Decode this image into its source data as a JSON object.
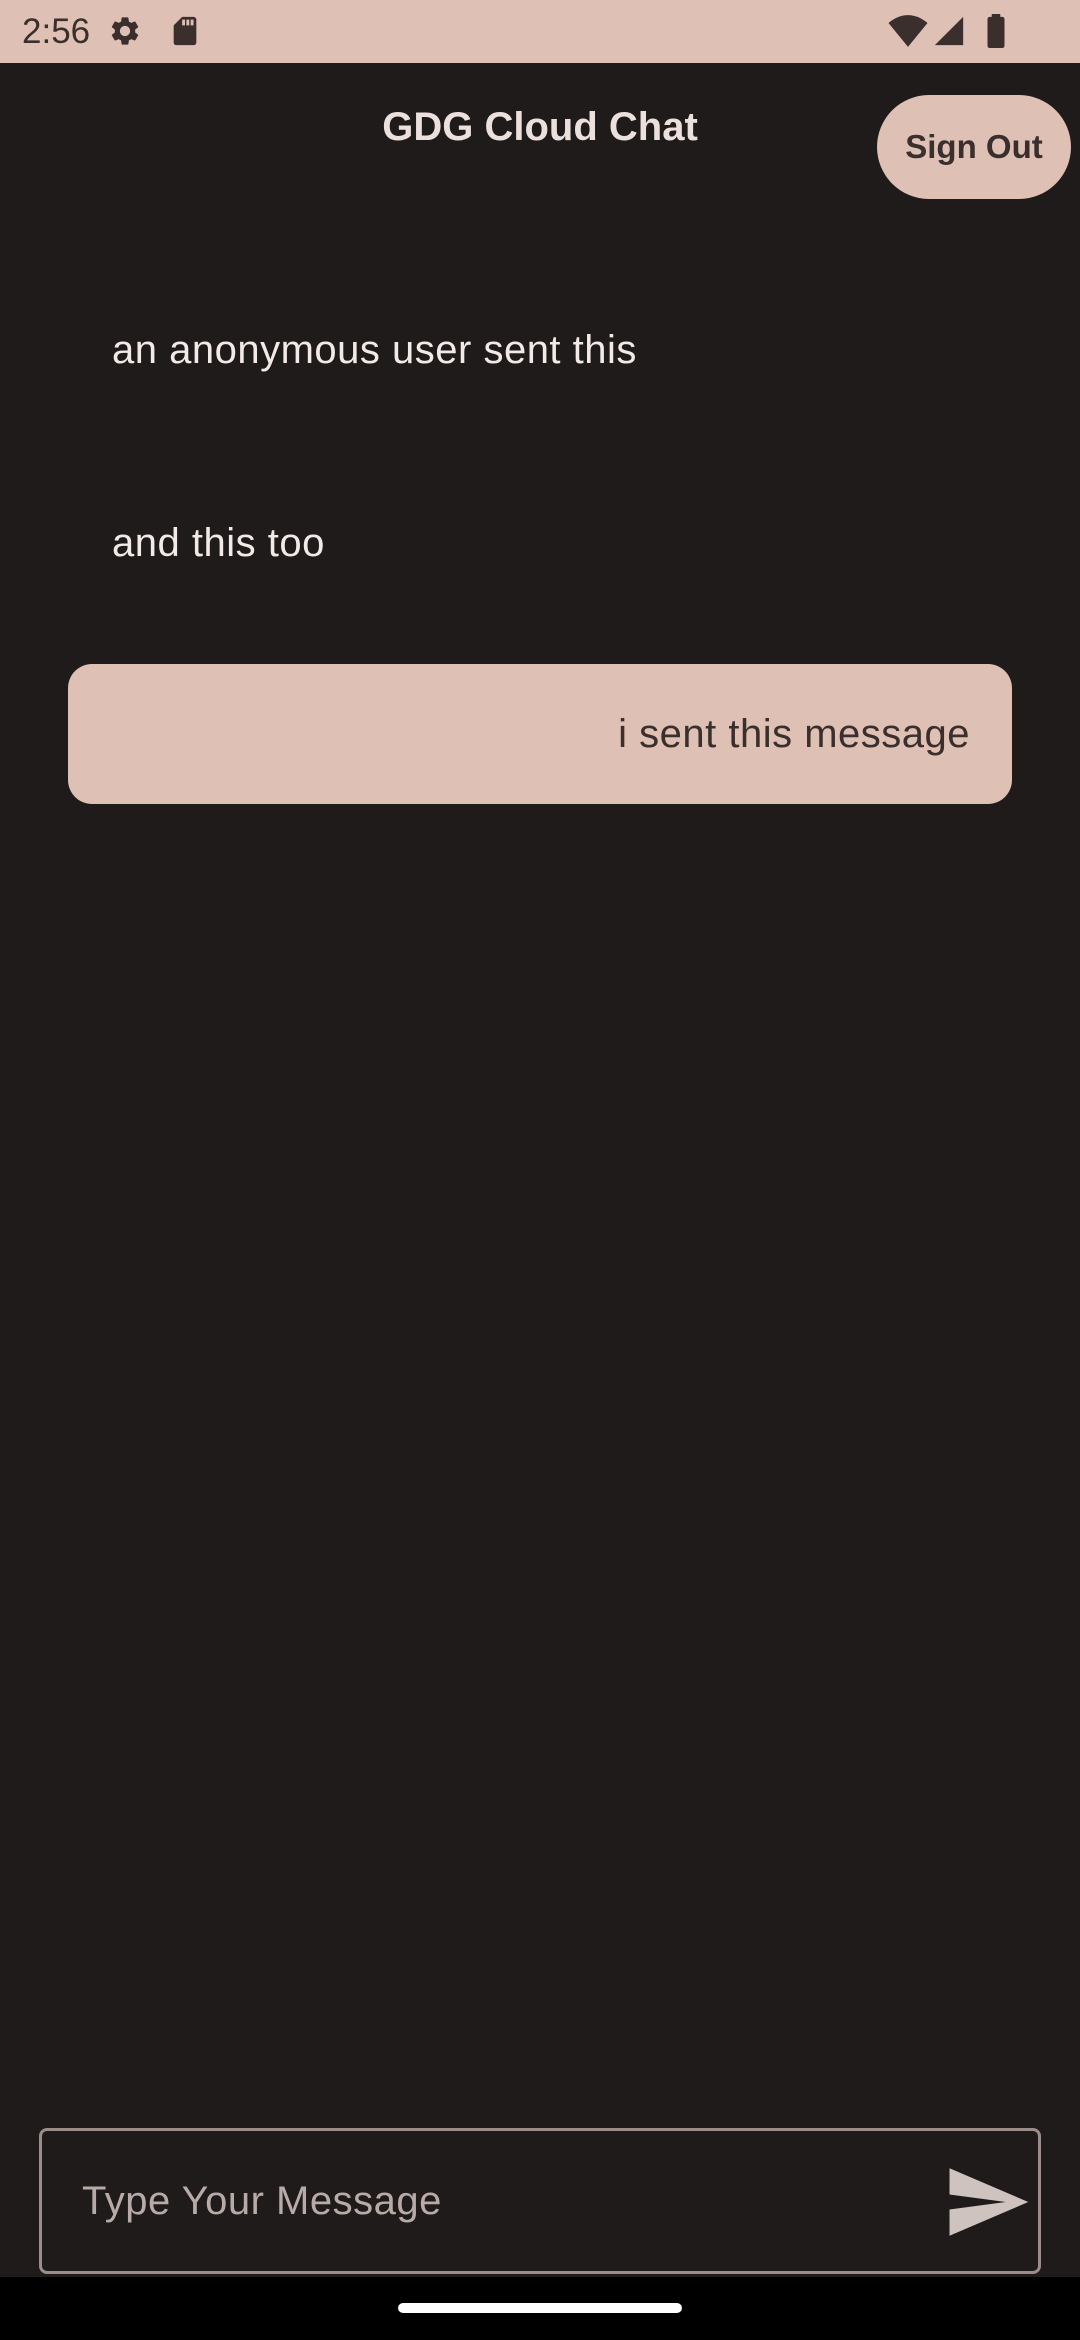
{
  "status_bar": {
    "time": "2:56",
    "icons": [
      "settings-gear-icon",
      "sd-card-icon",
      "wifi-icon",
      "cell-signal-icon",
      "battery-icon"
    ]
  },
  "app": {
    "title": "GDG Cloud Chat",
    "sign_out_label": "Sign Out"
  },
  "messages": [
    {
      "text": "an anonymous user sent this",
      "sender": "other"
    },
    {
      "text": "and this too",
      "sender": "other"
    },
    {
      "text": "i sent this message",
      "sender": "me"
    }
  ],
  "composer": {
    "placeholder": "Type Your Message",
    "value": "",
    "send_icon": "send-icon"
  },
  "colors": {
    "background": "#1f1b1b",
    "accent": "#dfc0b5",
    "on_accent": "#3a2f2c",
    "text_primary": "#ece0dd",
    "outline": "#9b8d8a"
  }
}
